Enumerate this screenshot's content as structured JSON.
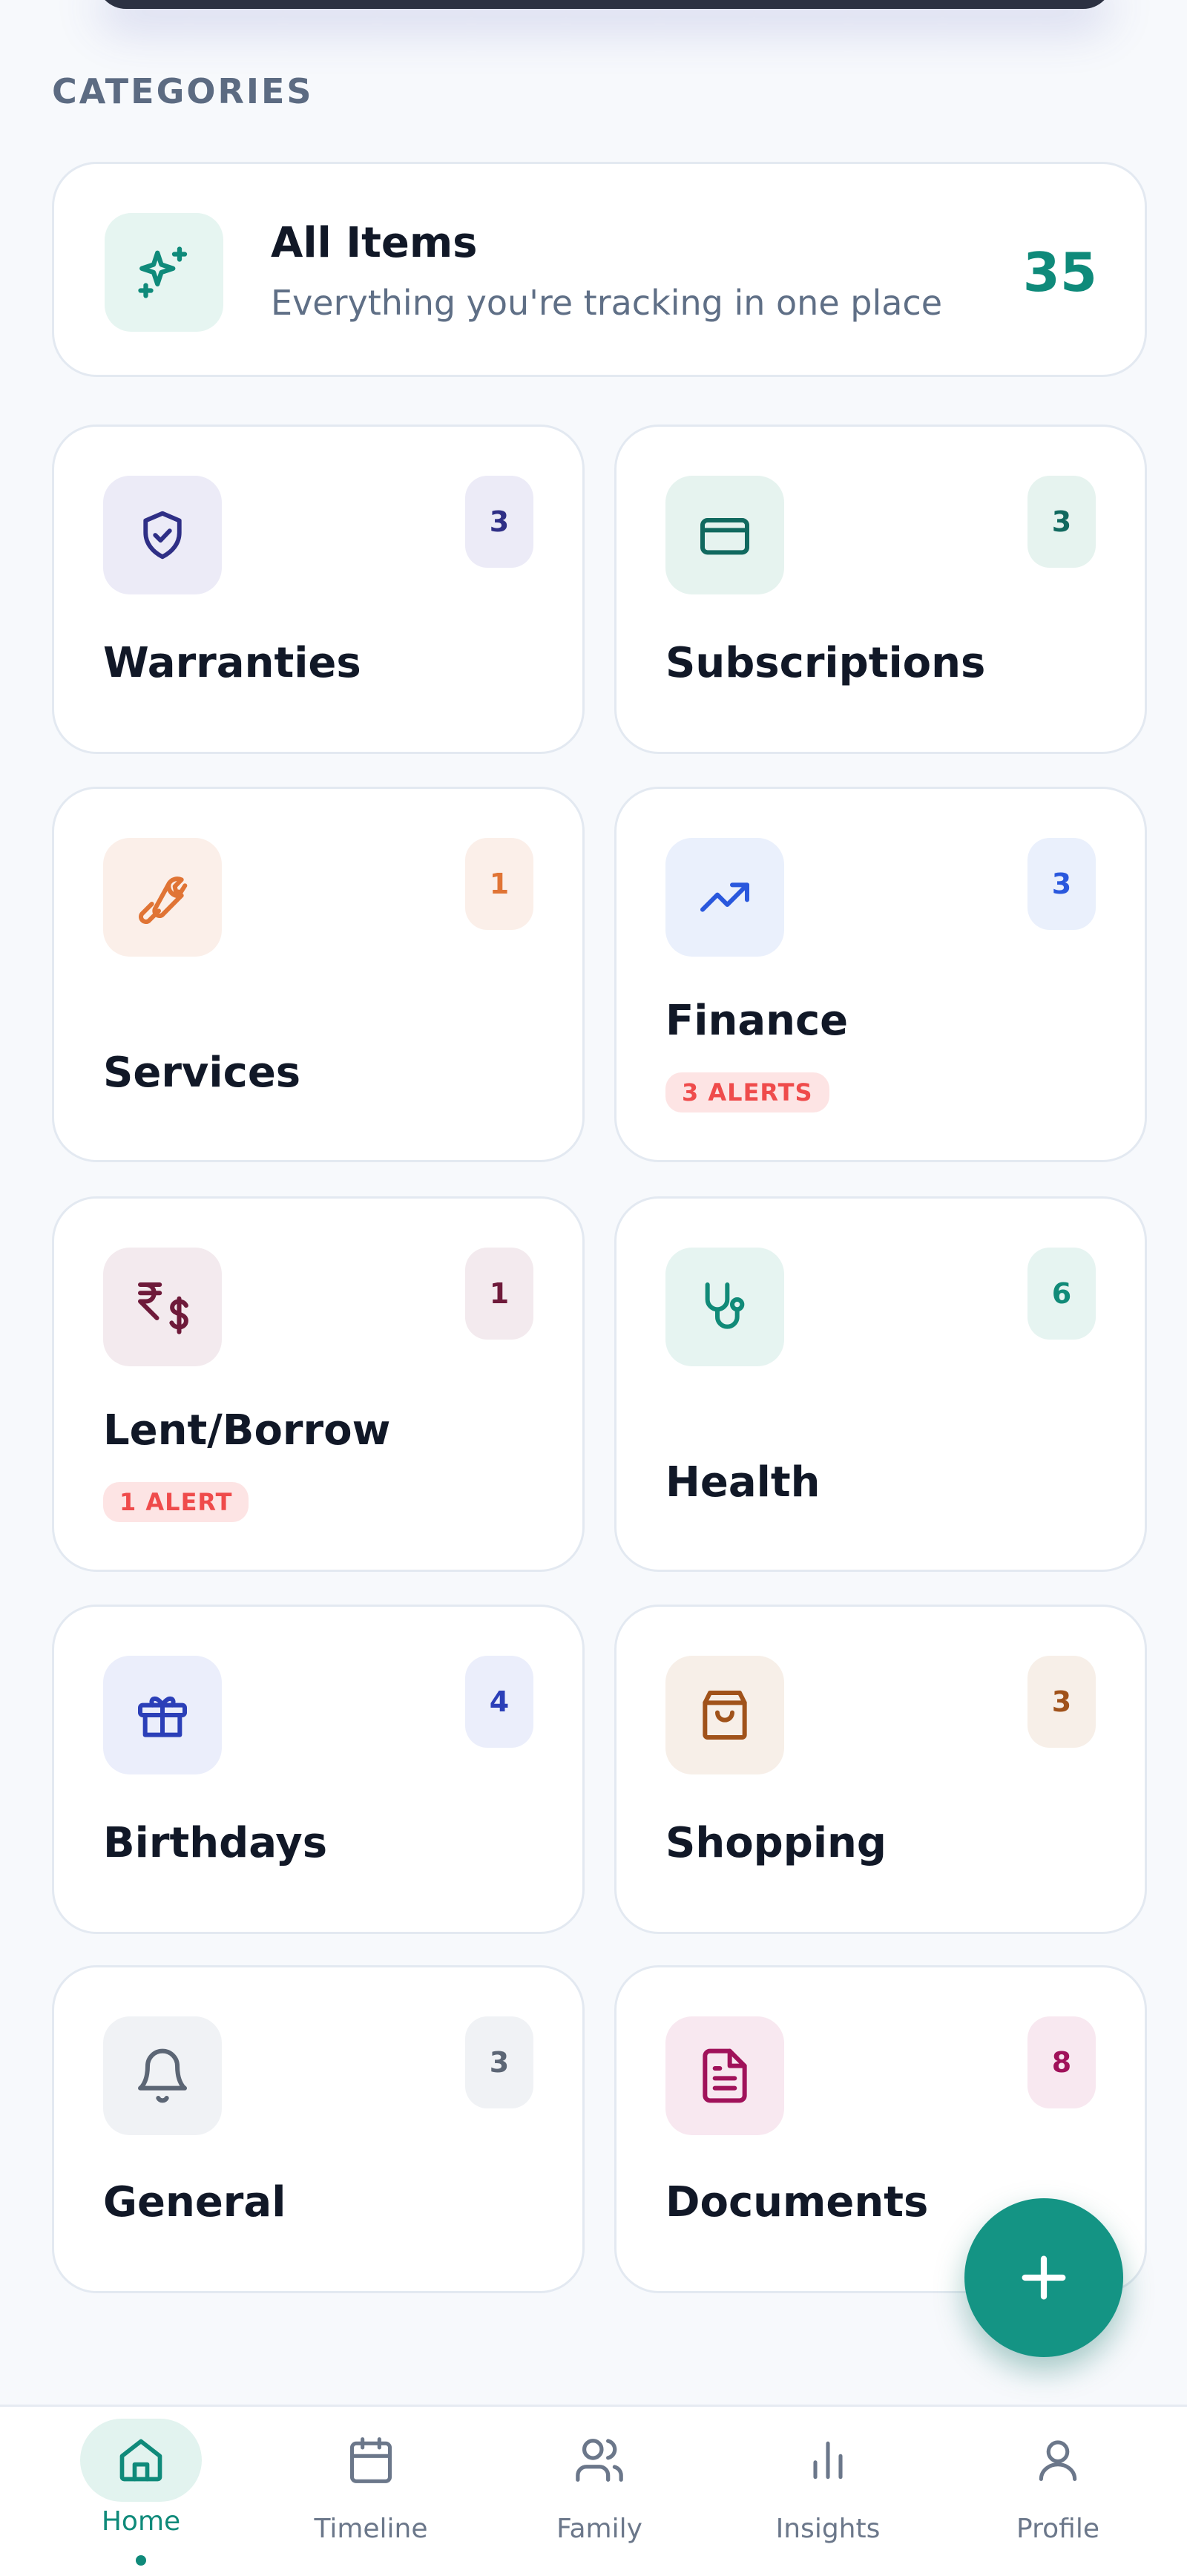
{
  "section_title": "CATEGORIES",
  "all_items": {
    "title": "All Items",
    "subtitle": "Everything you're tracking in one place",
    "count": "35",
    "icon": "sparkles-icon",
    "accent": "#0f8a7a"
  },
  "categories": [
    {
      "label": "Warranties",
      "count": "3",
      "icon": "shield-check-icon",
      "color": "#2f2f86",
      "bg": "#ecebf7",
      "alert": ""
    },
    {
      "label": "Subscriptions",
      "count": "3",
      "icon": "credit-card-icon",
      "color": "#11695f",
      "bg": "#e6f3ef",
      "alert": ""
    },
    {
      "label": "Services",
      "count": "1",
      "icon": "wrench-icon",
      "color": "#e07435",
      "bg": "#fbefe9",
      "alert": ""
    },
    {
      "label": "Finance",
      "count": "3",
      "icon": "trending-up-icon",
      "color": "#2a58dd",
      "bg": "#eaf0fc",
      "alert": "3 ALERTS"
    },
    {
      "label": "Lent/Borrow",
      "count": "1",
      "icon": "rupee-dollar-icon",
      "color": "#6e1a3a",
      "bg": "#f3eaee",
      "alert": "1 ALERT"
    },
    {
      "label": "Health",
      "count": "6",
      "icon": "stethoscope-icon",
      "color": "#118a78",
      "bg": "#e6f4f1",
      "alert": ""
    },
    {
      "label": "Birthdays",
      "count": "4",
      "icon": "gift-icon",
      "color": "#2b3fb8",
      "bg": "#ebeefb",
      "alert": ""
    },
    {
      "label": "Shopping",
      "count": "3",
      "icon": "shopping-bag-icon",
      "color": "#a0521a",
      "bg": "#f7efe8",
      "alert": ""
    },
    {
      "label": "General",
      "count": "3",
      "icon": "bell-icon",
      "color": "#5c6675",
      "bg": "#f0f2f5",
      "alert": ""
    },
    {
      "label": "Documents",
      "count": "8",
      "icon": "document-icon",
      "color": "#a0125a",
      "bg": "#f8e8f0",
      "alert": ""
    }
  ],
  "fab": {
    "icon": "plus-icon",
    "color": "#149484"
  },
  "nav": [
    {
      "label": "Home",
      "icon": "home-icon",
      "active": true
    },
    {
      "label": "Timeline",
      "icon": "calendar-icon",
      "active": false
    },
    {
      "label": "Family",
      "icon": "users-icon",
      "active": false
    },
    {
      "label": "Insights",
      "icon": "bar-chart-icon",
      "active": false
    },
    {
      "label": "Profile",
      "icon": "user-icon",
      "active": false
    }
  ]
}
